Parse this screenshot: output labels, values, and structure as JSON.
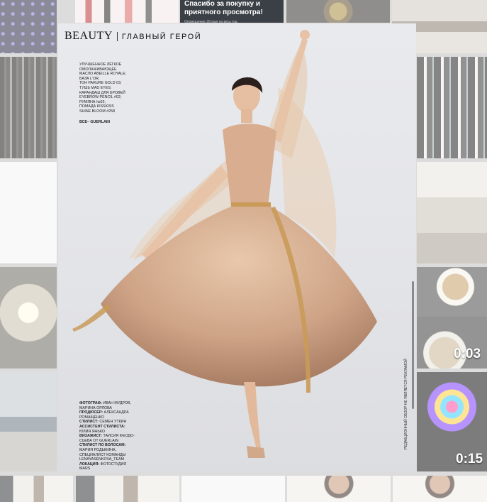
{
  "toast": {
    "title": "Спасибо за покупку и приятного просмотра!",
    "subtitle": "Оповещение 28 мая на весь год"
  },
  "thumbnails": {
    "video_1_duration": "0:03",
    "video_2_duration": "0:15"
  },
  "magazine": {
    "brand": "BEAUTY",
    "section": "ГЛАВНЫЙ ГЕРОЙ",
    "products": [
      "УЛУЧШЕННОЕ ЛЁГКОЕ",
      "ОМОЛАЖИВАЮЩЕЕ",
      "МАСЛО ABEILLE ROYALE;",
      "БАЗА L'OR;",
      "ТОН PARURE GOLD 03;",
      "ТУШЬ MAD EYES;",
      "КАРАНДАШ ДЛЯ БРОВЕЙ",
      "EYEBROW PENCIL #02;",
      "РУМЯНА №02;",
      "ПОМАДА KISSKISS",
      "SHINE BLOOM #258"
    ],
    "products_all": "ВСЕ– GUERLAIN",
    "credits": [
      {
        "role": "ФОТОГРАФ:",
        "text": " ИВАН МУДРОВ,"
      },
      {
        "role": "",
        "text": "МАРИНА ОРЛОВА"
      },
      {
        "role": "ПРОДЮСЕР:",
        "text": " АЛЕКСАНДРА"
      },
      {
        "role": "",
        "text": "РОМАЩЕНКО"
      },
      {
        "role": "СТИЛИСТ:",
        "text": " СЕМЕН УТКИН"
      },
      {
        "role": "АССИСТЕНТ СТИЛИСТА:",
        "text": ""
      },
      {
        "role": "",
        "text": "ЮЛИЯ ЯНЬКО"
      },
      {
        "role": "ВИЗАЖИСТ:",
        "text": " ТАИСИЯ ФЕОДО-"
      },
      {
        "role": "",
        "text": "СЬЕВА ОТ GUERLAIN"
      },
      {
        "role": "СТИЛИСТ ПО ВОЛОСАМ:",
        "text": ""
      },
      {
        "role": "",
        "text": "МАРИЯ РОДЫКИНА,"
      },
      {
        "role": "",
        "text": "СПЕЦИАЛИСТ КОМАНДЫ"
      },
      {
        "role": "",
        "text": "LENAYASENKOVA_TEAM"
      },
      {
        "role": "ЛОКАЦИЯ:",
        "text": " ФОТОСТУДИЯ"
      },
      {
        "role": "",
        "text": "MARS"
      }
    ],
    "side_note": "РЕДАКЦИОННЫЙ ОБЗОР НЕ ЯВЛЯЕТСЯ РЕКЛАМОЙ"
  },
  "colors": {
    "dress": "#d9b293",
    "tulle": "#e6c6a8",
    "satin_ribbon": "#c99a58",
    "page_bg": "#e6e7eb"
  }
}
